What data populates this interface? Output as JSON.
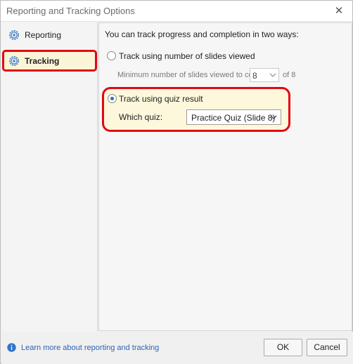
{
  "window": {
    "title": "Reporting and Tracking Options",
    "close_glyph": "✕"
  },
  "sidebar": {
    "items": [
      {
        "label": "Reporting",
        "icon": "gear-icon",
        "selected": false
      },
      {
        "label": "Tracking",
        "icon": "gear-icon",
        "selected": true
      }
    ]
  },
  "tracking": {
    "intro": "You can track progress and completion in two ways:",
    "option_slides": {
      "label": "Track using number of slides viewed",
      "checked": false
    },
    "min_slides": {
      "label": "Minimum number of slides viewed to complete:",
      "value": "8",
      "of_label": "of 8"
    },
    "option_quiz": {
      "label": "Track using quiz result",
      "checked": true
    },
    "which_quiz": {
      "label": "Which quiz:",
      "selected": "Practice Quiz (Slide 8)"
    }
  },
  "footer": {
    "learn_more": "Learn more about reporting and tracking",
    "ok_label": "OK",
    "cancel_label": "Cancel"
  },
  "colors": {
    "highlight_border": "#e30613",
    "highlight_fill": "#fdf8dc",
    "link": "#2e62b3",
    "radio_dot": "#2a6fb5"
  }
}
